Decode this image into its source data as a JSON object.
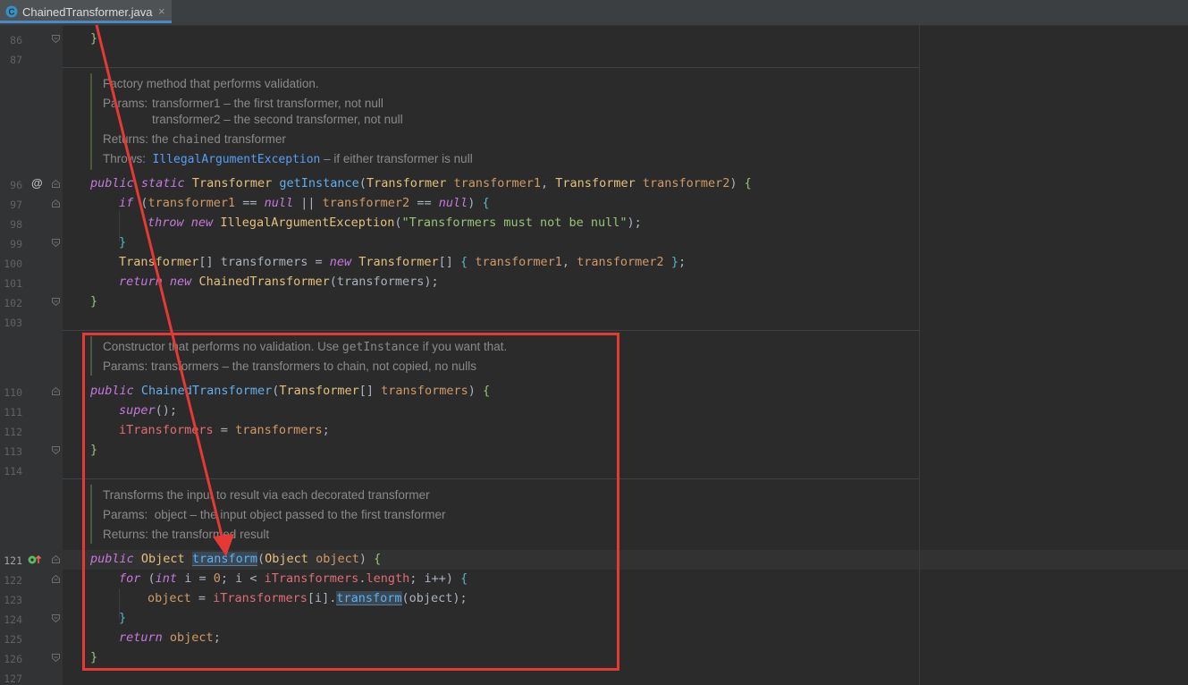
{
  "tab": {
    "filename": "ChainedTransformer.java",
    "close": "×"
  },
  "line_numbers": {
    "l86": "86",
    "l87": "87",
    "l96": "96",
    "l97": "97",
    "l98": "98",
    "l99": "99",
    "l100": "100",
    "l101": "101",
    "l102": "102",
    "l103": "103",
    "l110": "110",
    "l111": "111",
    "l112": "112",
    "l113": "113",
    "l114": "114",
    "l121": "121",
    "l122": "122",
    "l123": "123",
    "l124": "124",
    "l125": "125",
    "l126": "126",
    "l127": "127"
  },
  "gutter": {
    "override_marker": "@"
  },
  "doc1": {
    "summary": "Factory method that performs validation.",
    "params_label": "Params:",
    "param1": "transformer1 – the first transformer, not null",
    "param2": "transformer2 – the second transformer, not null",
    "returns_label": "Returns:",
    "returns_pre": "the ",
    "returns_code": "chained",
    "returns_post": " transformer",
    "throws_label": "Throws:",
    "throws_link": "IllegalArgumentException",
    "throws_post": " – if either transformer is null"
  },
  "doc2": {
    "summary_pre": "Constructor that performs no validation. Use ",
    "summary_code": "getInstance",
    "summary_post": " if you want that.",
    "params": "Params: transformers – the transformers to chain, not copied, no nulls"
  },
  "doc3": {
    "summary": "Transforms the input to result via each decorated transformer",
    "params_label": "Params:",
    "param1": "object – the input object passed to the first transformer",
    "returns": "Returns: the transformed result"
  },
  "code": {
    "public": "public",
    "static": "static",
    "if": "if",
    "throw": "throw",
    "new": "new",
    "return": "return",
    "super": "super",
    "for": "for",
    "int": "int",
    "null": "null",
    "Transformer": "Transformer",
    "Object": "Object",
    "ChainedTransformer": "ChainedTransformer",
    "IllegalArgumentException": "IllegalArgumentException",
    "getInstance": "getInstance",
    "transform": "transform",
    "transformer1": "transformer1",
    "transformer2": "transformer2",
    "transformers": "transformers",
    "iTransformers": "iTransformers",
    "object": "object",
    "length": "length",
    "i": "i",
    "zero": "0",
    "message": "\"Transformers must not be null\""
  }
}
